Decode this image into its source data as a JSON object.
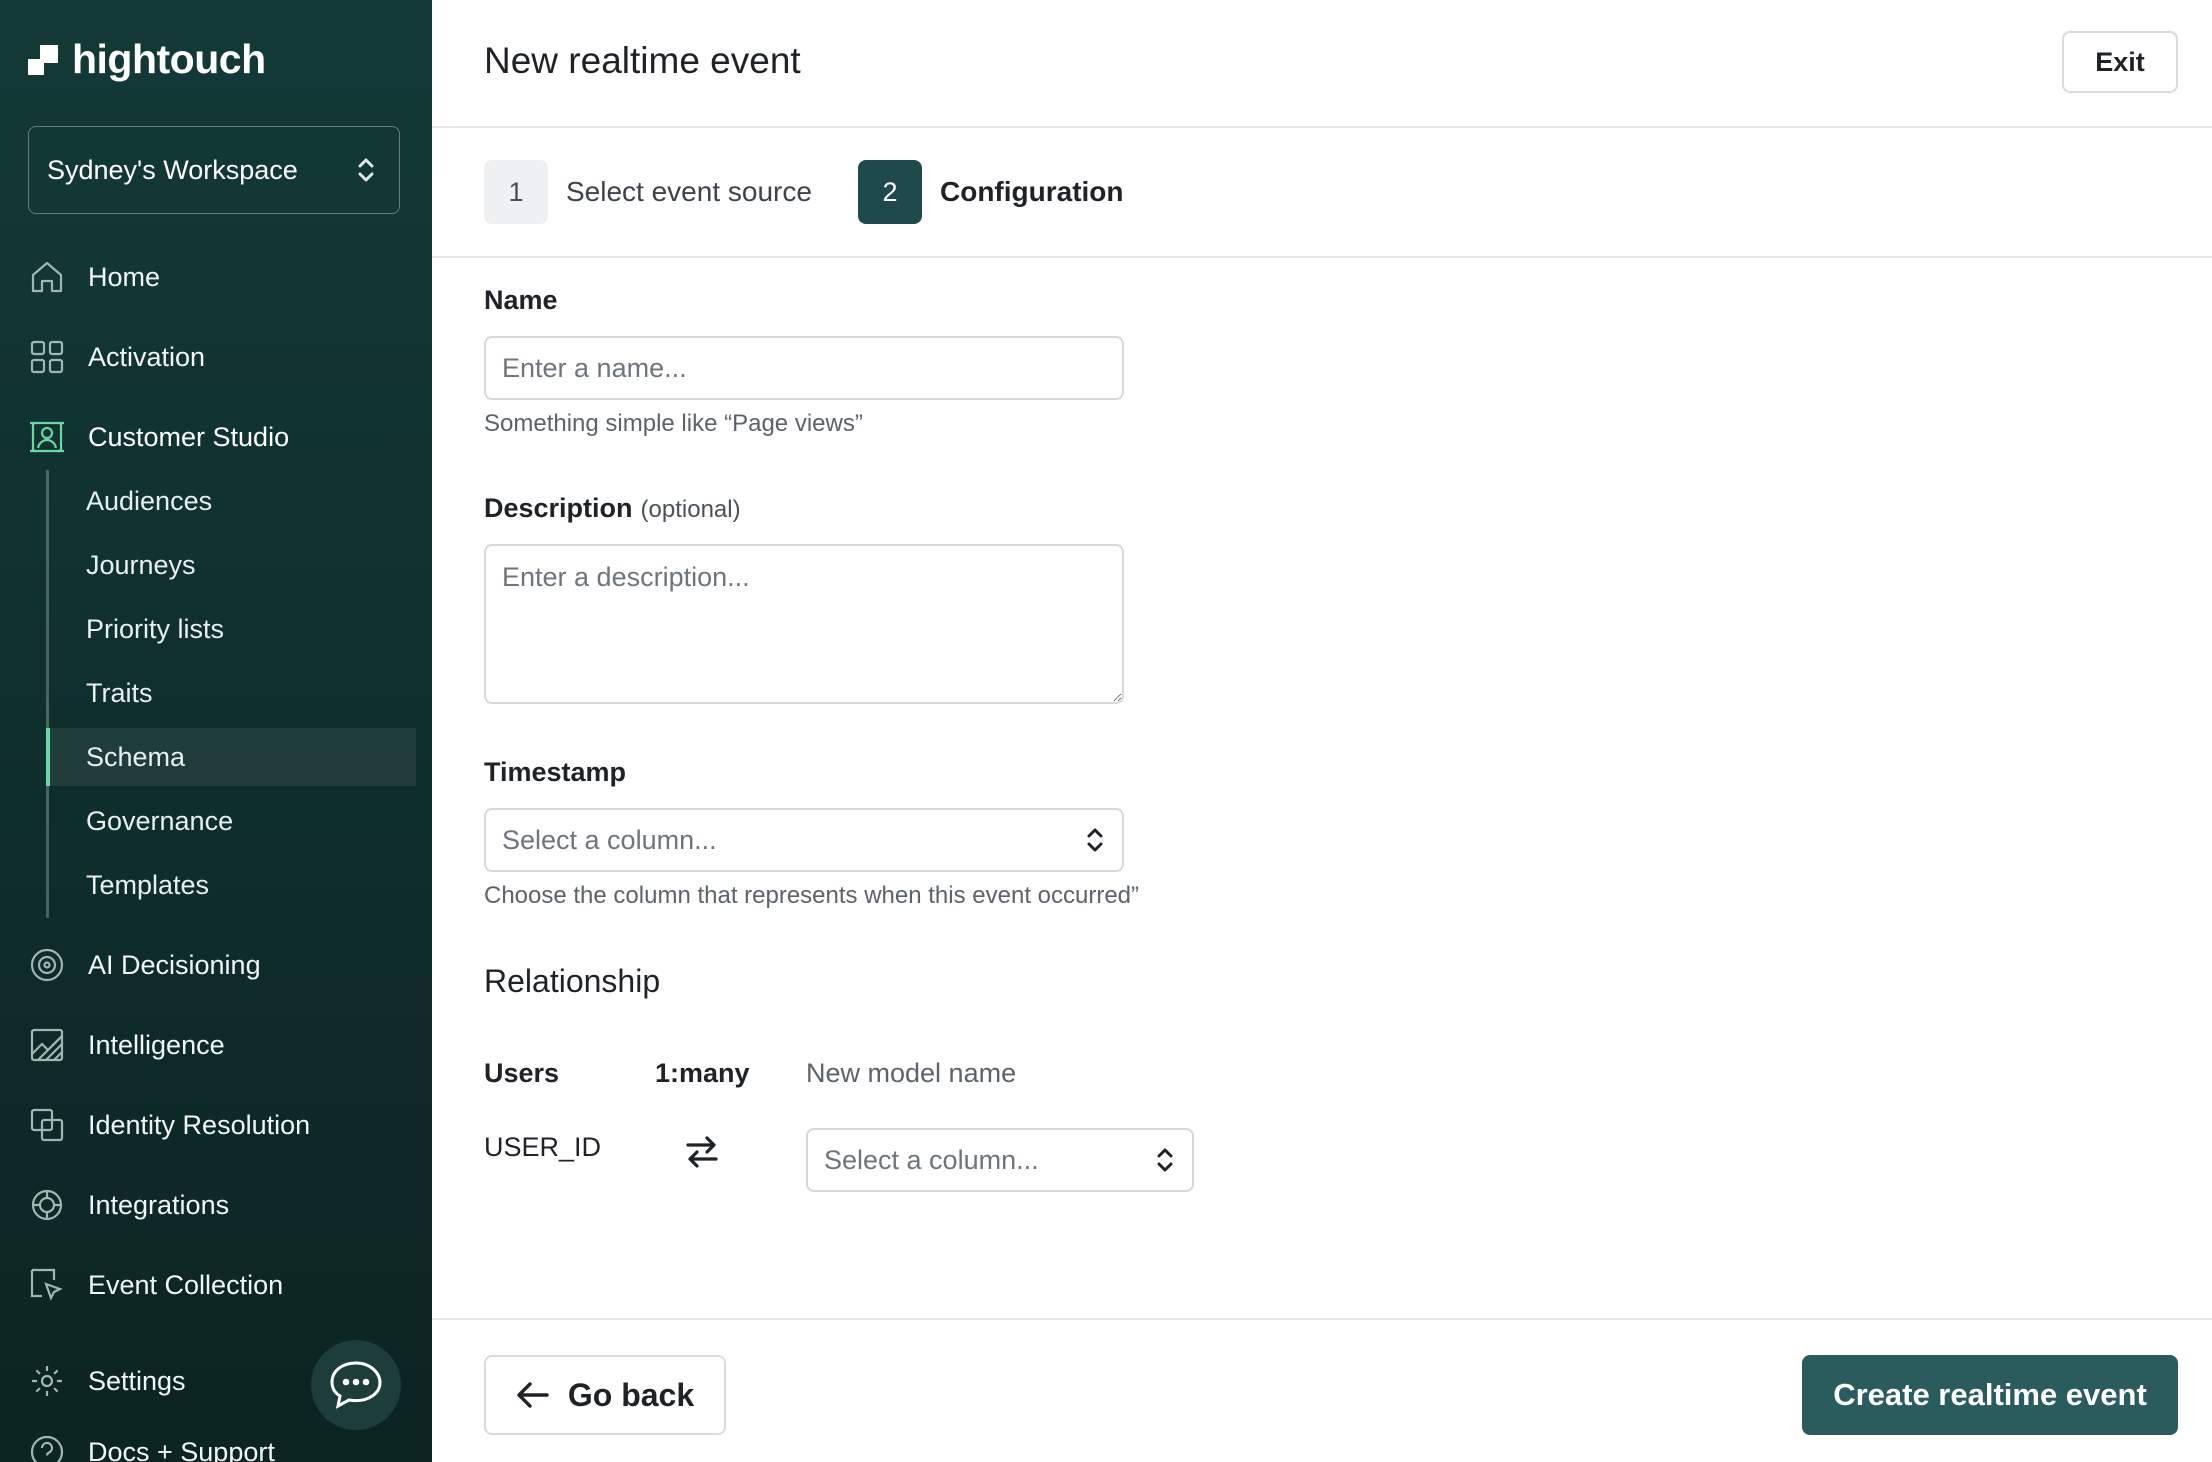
{
  "brand": {
    "name": "hightouch"
  },
  "workspace": {
    "name": "Sydney's Workspace"
  },
  "sidebar": {
    "items": [
      {
        "label": "Home",
        "icon": "home-icon"
      },
      {
        "label": "Activation",
        "icon": "activation-icon"
      },
      {
        "label": "Customer Studio",
        "icon": "customer-studio-icon"
      },
      {
        "label": "AI Decisioning",
        "icon": "ai-decisioning-icon"
      },
      {
        "label": "Intelligence",
        "icon": "intelligence-icon"
      },
      {
        "label": "Identity Resolution",
        "icon": "identity-resolution-icon"
      },
      {
        "label": "Integrations",
        "icon": "integrations-icon"
      },
      {
        "label": "Event Collection",
        "icon": "event-collection-icon"
      },
      {
        "label": "Settings",
        "icon": "settings-icon"
      },
      {
        "label": "Docs + Support",
        "icon": "help-icon"
      }
    ],
    "sub_items": [
      "Audiences",
      "Journeys",
      "Priority lists",
      "Traits",
      "Schema",
      "Governance",
      "Templates"
    ],
    "selected_sub_item": "Schema"
  },
  "header": {
    "title": "New realtime event",
    "exit_label": "Exit"
  },
  "steps": [
    {
      "number": "1",
      "label": "Select event source"
    },
    {
      "number": "2",
      "label": "Configuration"
    }
  ],
  "form": {
    "name": {
      "label": "Name",
      "placeholder": "Enter a name...",
      "value": "",
      "help": "Something simple like “Page views”"
    },
    "description": {
      "label": "Description",
      "optional": "(optional)",
      "placeholder": "Enter a description...",
      "value": ""
    },
    "timestamp": {
      "label": "Timestamp",
      "placeholder": "Select a column...",
      "help": "Choose the column that represents when this event occurred”"
    }
  },
  "relationship": {
    "title": "Relationship",
    "from_model": "Users",
    "cardinality": "1:many",
    "to_model": "New model name",
    "from_column": "USER_ID",
    "to_column_placeholder": "Select a column..."
  },
  "footer": {
    "back_label": "Go back",
    "create_label": "Create realtime event"
  },
  "colors": {
    "sidebar_bg": "#133a38",
    "primary": "#2a5b5d",
    "active_indicator": "#6bd6a1"
  }
}
